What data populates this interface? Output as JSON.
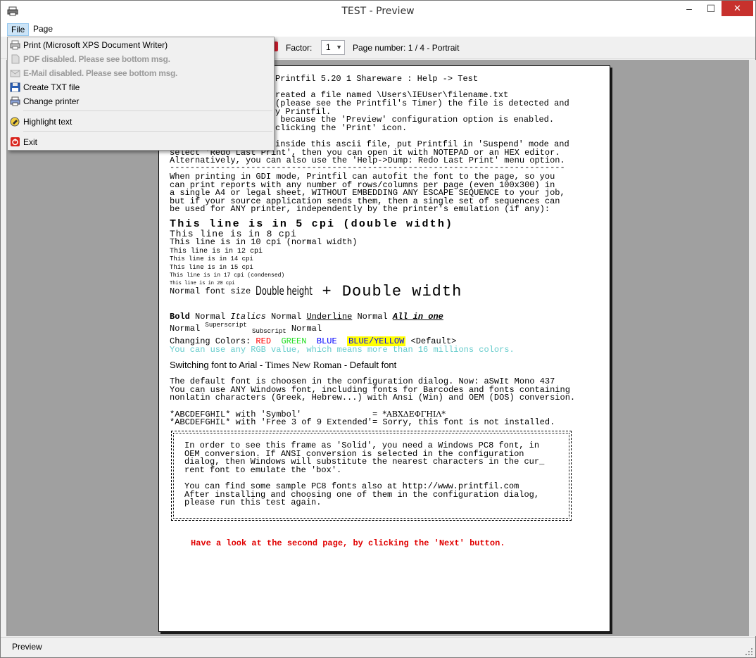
{
  "window": {
    "title": "TEST - Preview"
  },
  "menubar": {
    "file": "File",
    "page": "Page"
  },
  "toolbar": {
    "factor_label": "Factor:",
    "factor_value": "1",
    "page_number": "Page number: 1 / 4 - Portrait"
  },
  "file_menu": {
    "print": "Print (Microsoft XPS Document Writer)",
    "pdf": "PDF disabled. Please see bottom msg.",
    "email": "E-Mail disabled. Please see bottom msg.",
    "create_txt": "Create TXT file",
    "change_printer": "Change printer",
    "highlight": "Highlight text",
    "exit": "Exit"
  },
  "document": {
    "l01": "Printfil 5.20 1 Shareware : Help -> Test",
    "l02": "reated a file named \\Users\\IEUser\\filename.txt",
    "l03": "(please see the Printfil's Timer) the file is detected and",
    "l04": "y Printfil.",
    "l05": " because the 'Preview' configuration option is enabled.",
    "l06": "clicking the 'Print' icon.",
    "l07": "inside this ascii file, put Printfil in 'Suspend' mode and",
    "l08": "select 'Redo Last Print', then you can open it with NOTEPAD or an HEX editor.",
    "l09": "Alternatively, you can also use the 'Help->Dump: Redo Last Print' menu option.",
    "l10": "------------------------------------------------------------------------------",
    "l11": "When printing in GDI mode, Printfil can autofit the font to the page, so you",
    "l12": "can print reports with any number of rows/columns per page (even 100x300) in",
    "l13": "a single A4 or legal sheet, WITHOUT EMBEDDING ANY ESCAPE SEQUENCE to your job,",
    "l14": "but if your source application sends them, then a single set of sequences can",
    "l15": "be used for ANY printer, independently by the printer's emulation (if any):",
    "cpi5": "This line is in 5 cpi (double width)",
    "cpi8": "This line is in 8 cpi",
    "cpi10": "This line is in 10 cpi (normal width)",
    "cpi12": "This line is in 12 cpi",
    "cpi14": "This line is in 14 cpi",
    "cpi15": "This line is in 15 cpi",
    "cpi17": "This line is in 17 cpi (condensed)",
    "cpi20": "This line is in 20 cpi",
    "normal_size": "Normal font size ",
    "double_height": "Double height",
    "double_width": " + Double width",
    "bold": "Bold",
    "normal": " Normal ",
    "italics": "Italics",
    "underline": "Underline",
    "all_in_one": "All in one",
    "normal2": "Normal ",
    "superscript": "Superscript",
    "subscript": "Subscript",
    "normal3": " Normal",
    "colors_label": "Changing Colors: ",
    "red": "RED",
    "green": "GREEN",
    "blue": "BLUE",
    "blue_yellow": "BLUE/YELLOW",
    "default": " <Default>",
    "rgb_line": "You can use any RGB value, which means more than 16 millions colors.",
    "switch_font": "Switching font to Arial - ",
    "times": "Times New Roman",
    "default_font": " - Default font",
    "d01": "The default font is choosen in the configuration dialog. Now: aSwIt Mono 437",
    "d02": "You can use ANY Windows font, including fonts for Barcodes and fonts containing",
    "d03": "nonlatin characters (Greek, Hebrew...) with Ansi (Win) and OEM (DOS) conversion.",
    "sym1_left": "*ABCDEFGHIL* with 'Symbol'              = ",
    "sym1_right": "*ΑΒΧΔΕΦΓΗΙΛ*",
    "sym2": "*ABCDEFGHIL* with 'Free 3 of 9 Extended'= Sorry, this font is not installed.",
    "f01": "In order to see this frame as 'Solid', you need a Windows PC8 font, in",
    "f02": "OEM conversion. If ANSI conversion is selected in the configuration",
    "f03": "dialog, then Windows will substitute the nearest characters in the cur_",
    "f04": "rent font to emulate the 'box'.",
    "f05": "You can find some sample PC8 fonts also at http://www.printfil.com",
    "f06": "After installing and choosing one of them in the configuration dialog,",
    "f07": "please run this test again.",
    "next_msg": "Have a look at the second page, by clicking the 'Next' button."
  },
  "statusbar": {
    "text": "Preview"
  },
  "colors": {
    "red": "#ff0000",
    "green": "#00e000",
    "blue": "#0000ff",
    "yellow": "#ffff00",
    "cyan": "#66cccc",
    "next_red": "#e00000"
  }
}
